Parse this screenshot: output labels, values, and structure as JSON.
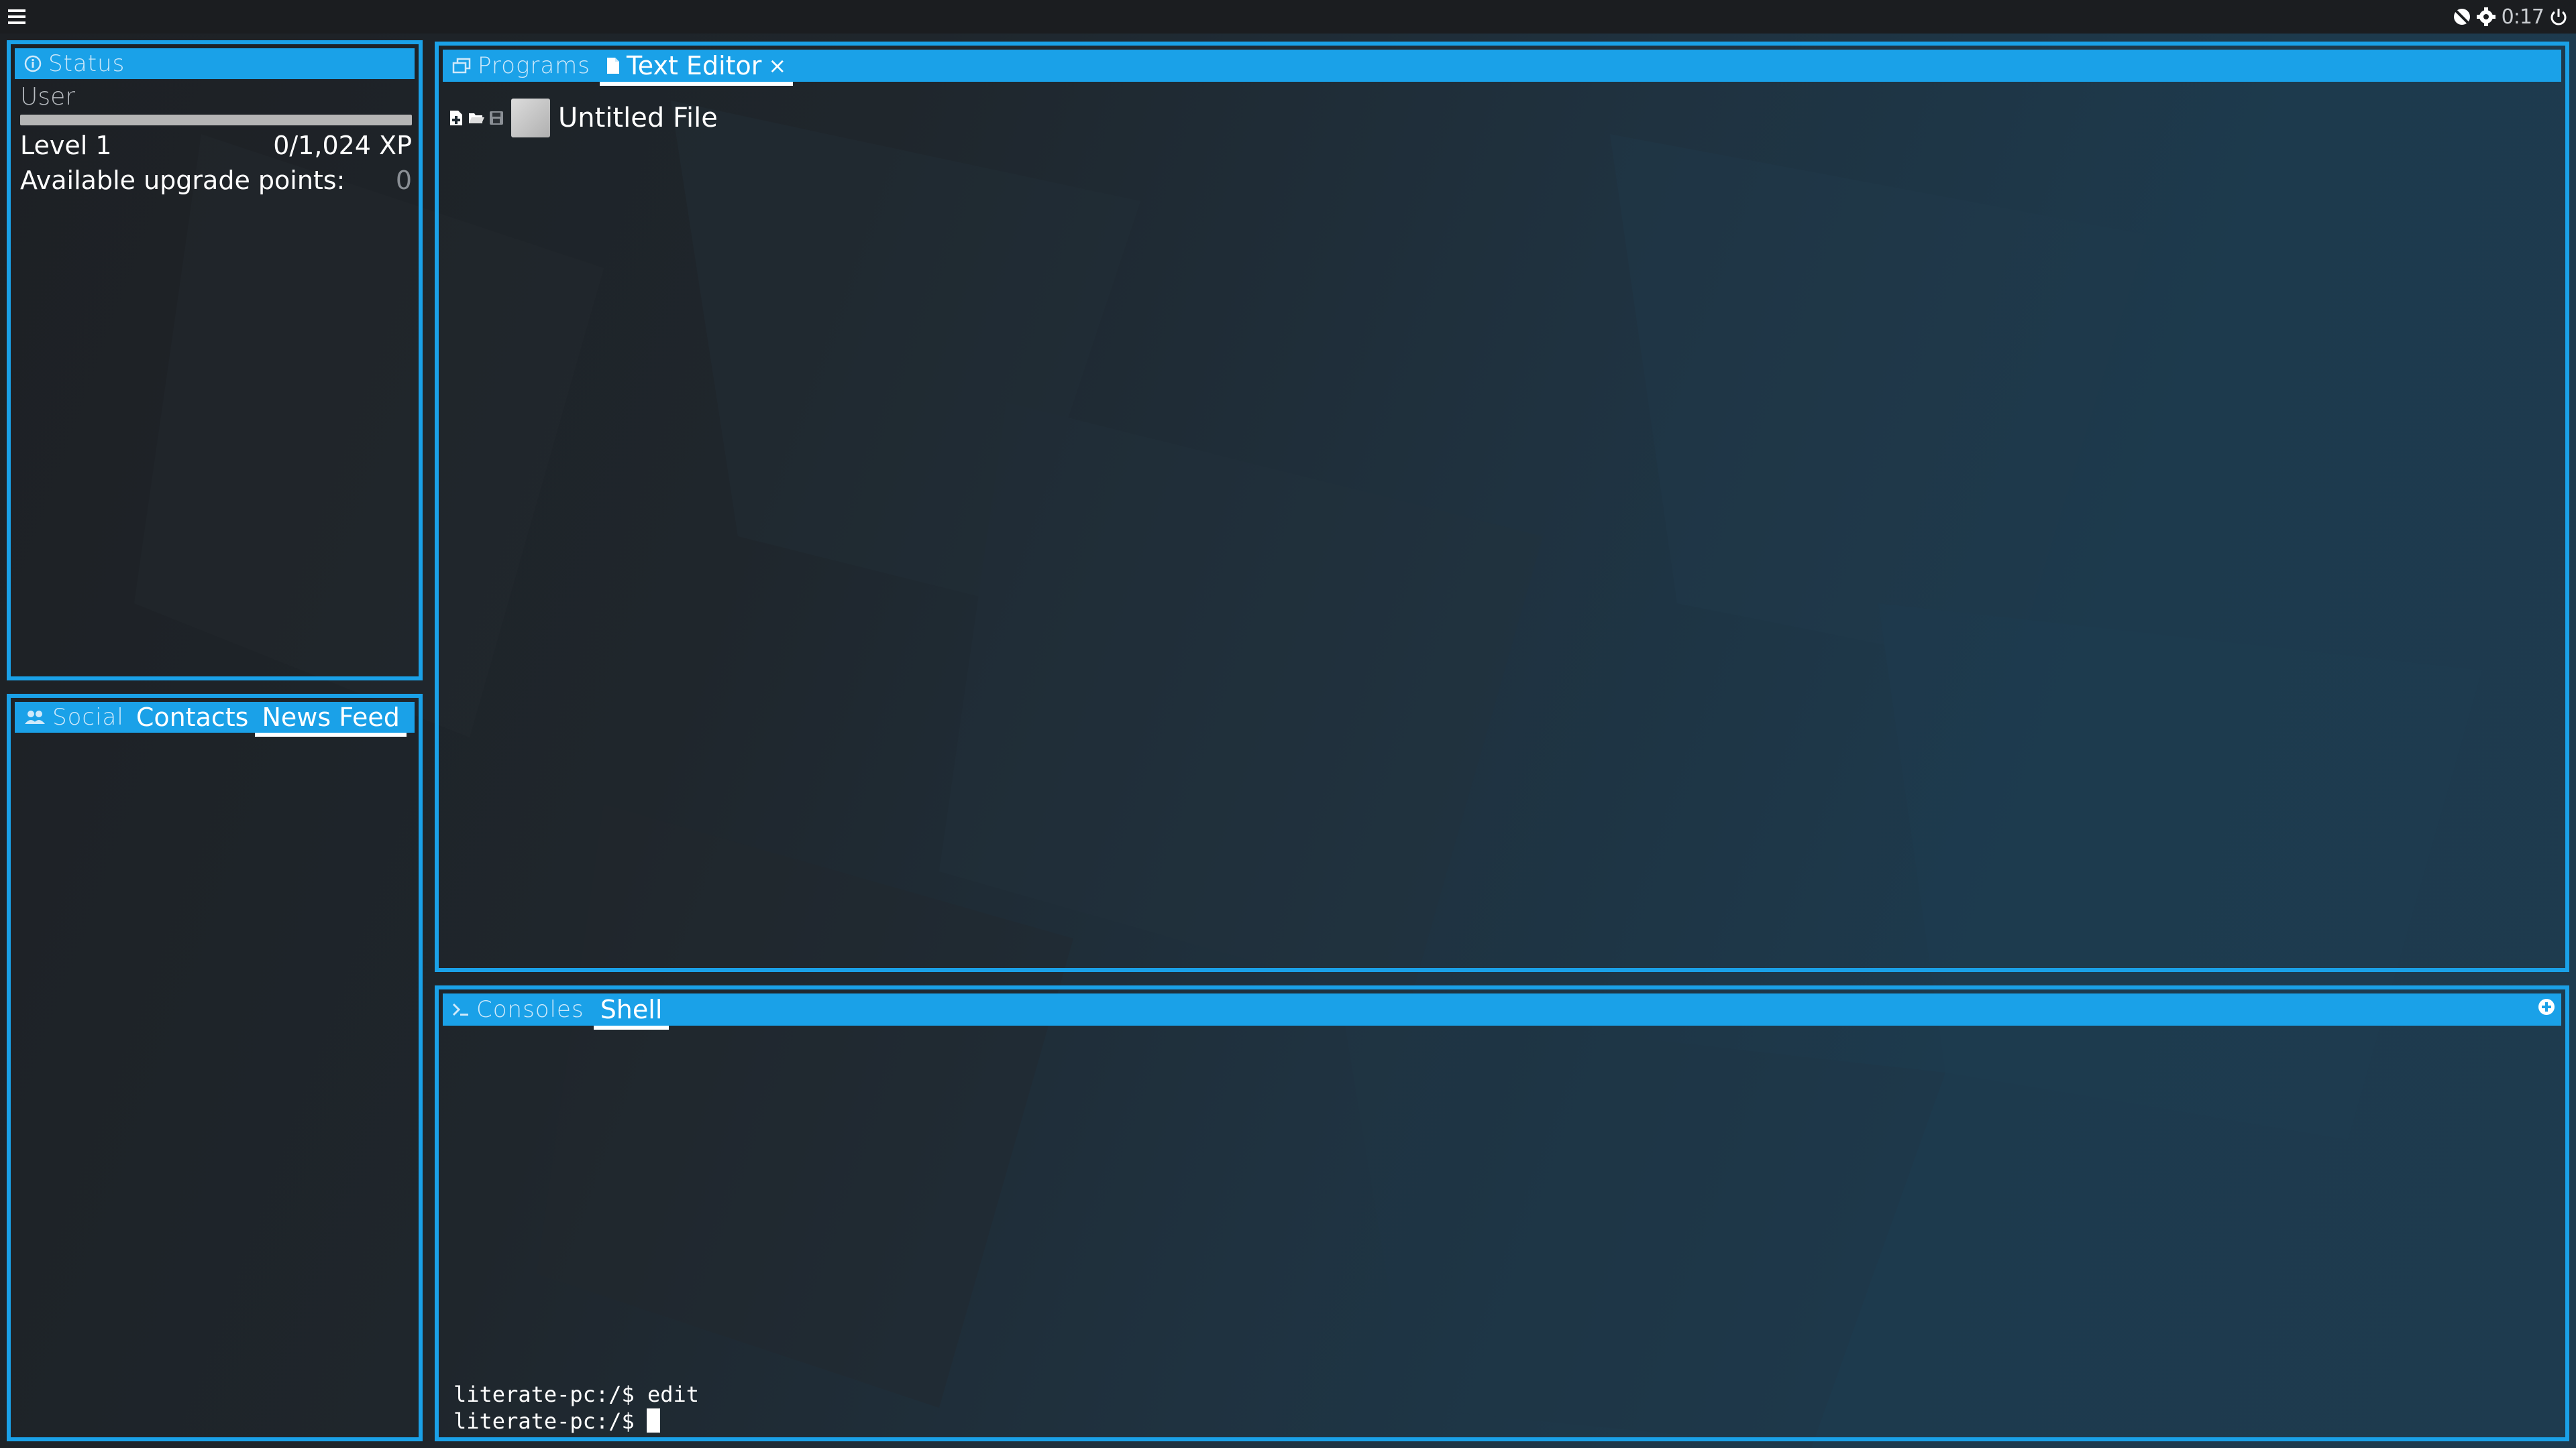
{
  "topbar": {
    "time": "0:17",
    "icons": [
      "menu-icon",
      "network-off-icon",
      "settings-icon",
      "power-icon"
    ]
  },
  "status_panel": {
    "title": "Status",
    "user_label": "User",
    "level": "Level 1",
    "xp": "0/1,024 XP",
    "xp_progress": 0,
    "upgrade_label": "Available upgrade points:",
    "upgrade_value": "0"
  },
  "social_panel": {
    "title": "Social",
    "tabs": [
      {
        "label": "Contacts",
        "active": false
      },
      {
        "label": "News Feed",
        "active": true
      }
    ]
  },
  "programs_panel": {
    "title": "Programs",
    "tabs": [
      {
        "label": "Text Editor",
        "active": true,
        "close": "×"
      }
    ],
    "editor": {
      "file_name": "Untitled File",
      "toolbar_icons": [
        "new-file-icon",
        "open-folder-icon",
        "save-icon"
      ]
    }
  },
  "consoles_panel": {
    "title": "Consoles",
    "tabs": [
      {
        "label": "Shell",
        "active": true
      }
    ],
    "terminal_lines": [
      "literate-pc:/$ edit",
      "literate-pc:/$"
    ]
  },
  "colors": {
    "accent": "#1aa1e8",
    "topbar": "#1b1d20"
  }
}
